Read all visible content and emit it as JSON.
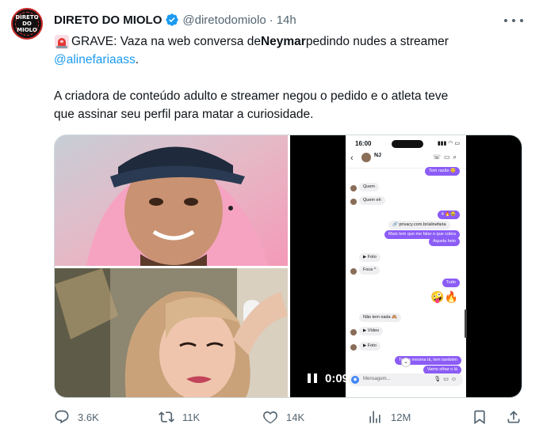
{
  "author": {
    "display_name": "DIRETO DO MIOLO",
    "handle": "@diretodomiolo",
    "separator": "·",
    "time": "14h",
    "avatar_text": [
      "DIRETO",
      "DO MIOLO"
    ],
    "verified_color": "#1d9bf0"
  },
  "tweet": {
    "prefix": "GRAVE: Vaza na web conversa de ",
    "name": "Neymar",
    "suffix": " pedindo nudes a streamer",
    "mention": "@alinefariaass",
    "period": ".",
    "body_line1": "A criadora de conteúdo adulto e streamer negou o pedido e o atleta teve",
    "body_line2": "que assinar seu perfil para matar a curiosidade.",
    "siren_icon": "rotating-light-icon"
  },
  "video": {
    "timecode": "0:09",
    "phone": {
      "status_time": "16:00",
      "status_icons": "▮▮▮ ◠ ▭",
      "contact": "NJ",
      "input_placeholder": "Mensagem...",
      "messages": [
        {
          "dir": "out",
          "text": "Tem razão 😊"
        },
        {
          "dir": "in",
          "text": "Quem"
        },
        {
          "dir": "in",
          "text": "Quem eh"
        },
        {
          "dir": "out",
          "text": "4 🔥😂"
        },
        {
          "dir": "out",
          "text": "🔗 privacy.com.br/alinefaria"
        },
        {
          "dir": "out",
          "text": "Mais tem que me falar o que cobra"
        },
        {
          "dir": "out",
          "text": "Aquela hein"
        },
        {
          "dir": "in",
          "text": "▶ Foto"
        },
        {
          "dir": "in",
          "text": "Foca ^"
        },
        {
          "dir": "out",
          "text": "Tudo"
        },
        {
          "dir": "in",
          "text": "Não tem nada 🙈"
        },
        {
          "dir": "in",
          "text": "▶ Vídeo"
        },
        {
          "dir": "in",
          "text": "▶ Foto"
        },
        {
          "dir": "out",
          "text": "Tem a mesma lá, tem também"
        },
        {
          "dir": "out",
          "text": "Vamo olhar o lá"
        }
      ],
      "emojis": "🤪🔥",
      "down_arrow": "⌄"
    }
  },
  "actions": {
    "reply_count": "3.6K",
    "retweet_count": "11K",
    "like_count": "14K",
    "views_count": "12M"
  },
  "colors": {
    "text_primary": "#0f1419",
    "text_secondary": "#536471",
    "link": "#1d9bf0",
    "border": "#cfd9de",
    "chat_outgoing": "#8b5cf6"
  }
}
